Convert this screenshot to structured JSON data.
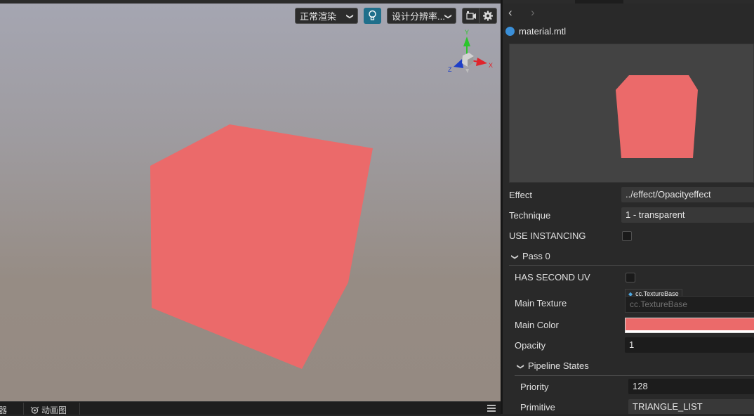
{
  "viewport": {
    "render_mode": "正常渲染",
    "resolution": "设计分辨率...",
    "gizmo_axes": {
      "x": "X",
      "y": "Y",
      "z": "Z"
    },
    "colors": {
      "cube": "#eb6a6a",
      "x_axis": "#e0242c",
      "y_axis": "#2cc52c",
      "z_axis": "#1d3ec8",
      "light_button": "#1f6f8b"
    }
  },
  "bottom_tabs": {
    "console": "器",
    "animation": "动画图"
  },
  "inspector": {
    "nav": {
      "back_icon": "chevron-left-icon",
      "forward_icon": "chevron-right-icon"
    },
    "file": {
      "icon": "material-icon",
      "name": "material.mtl"
    },
    "preview_color": "#eb6a6a",
    "properties": {
      "effect": {
        "label": "Effect",
        "value": "../effect/Opacityeffect"
      },
      "technique": {
        "label": "Technique",
        "value": "1 - transparent"
      },
      "use_instancing": {
        "label": "USE INSTANCING",
        "checked": false
      }
    },
    "pass0": {
      "title": "Pass 0",
      "has_second_uv": {
        "label": "HAS SECOND UV",
        "checked": false
      },
      "main_texture": {
        "label": "Main Texture",
        "type_badge": "cc.TextureBase",
        "placeholder": "cc.TextureBase"
      },
      "main_color": {
        "label": "Main Color",
        "value": "#eb6a6a"
      },
      "opacity": {
        "label": "Opacity",
        "value": "1"
      },
      "pipeline_states": {
        "title": "Pipeline States",
        "priority": {
          "label": "Priority",
          "value": "128"
        },
        "primitive": {
          "label": "Primitive",
          "value": "TRIANGLE_LIST"
        }
      }
    }
  }
}
